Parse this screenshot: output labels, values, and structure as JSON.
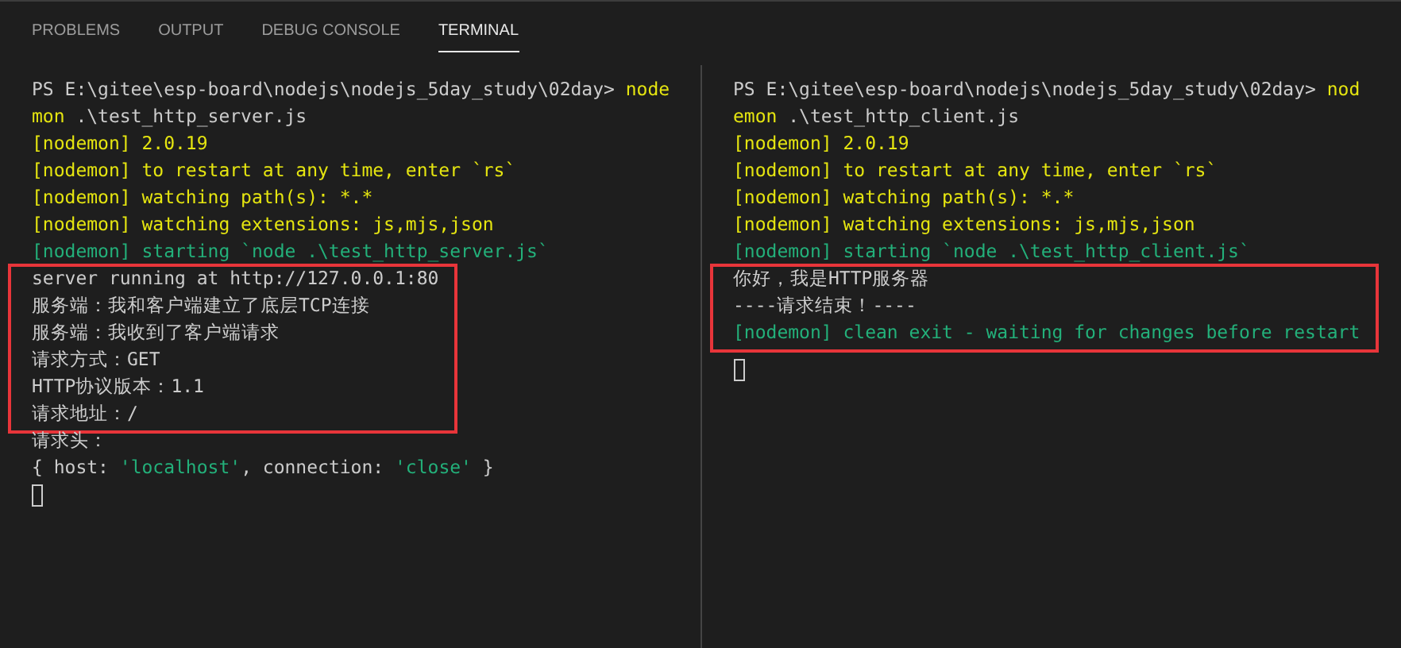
{
  "tabs": [
    {
      "label": "PROBLEMS",
      "selected": false
    },
    {
      "label": "OUTPUT",
      "selected": false
    },
    {
      "label": "DEBUG CONSOLE",
      "selected": false
    },
    {
      "label": "TERMINAL",
      "selected": true
    }
  ],
  "panes": [
    {
      "groups": [
        {
          "highlighted": false,
          "lines": [
            [
              {
                "text": "PS E:\\gitee\\esp-board\\nodejs\\nodejs_5day_study\\02day> ",
                "kind": "plain"
              },
              {
                "text": "node",
                "kind": "yellow"
              }
            ],
            [
              {
                "text": "mon",
                "kind": "yellow"
              },
              {
                "text": " .\\test_http_server.js",
                "kind": "plain"
              }
            ],
            [
              {
                "text": "[nodemon] 2.0.19",
                "kind": "yellow"
              }
            ],
            [
              {
                "text": "[nodemon] to restart at any time, enter `rs`",
                "kind": "yellow"
              }
            ],
            [
              {
                "text": "[nodemon] watching path(s): *.*",
                "kind": "yellow"
              }
            ],
            [
              {
                "text": "[nodemon] watching extensions: js,mjs,json",
                "kind": "yellow"
              }
            ],
            [
              {
                "text": "[nodemon] starting `node .\\test_http_server.js`",
                "kind": "green"
              }
            ]
          ]
        },
        {
          "highlighted": true,
          "lines": [
            [
              {
                "text": "server running at http://127.0.0.1:80",
                "kind": "plain"
              }
            ],
            [
              {
                "text": "服务端：我和客户端建立了底层TCP连接",
                "kind": "plain"
              }
            ],
            [
              {
                "text": "服务端：我收到了客户端请求",
                "kind": "plain"
              }
            ],
            [
              {
                "text": "请求方式：GET",
                "kind": "plain"
              }
            ],
            [
              {
                "text": "HTTP协议版本：1.1",
                "kind": "plain"
              }
            ],
            [
              {
                "text": "请求地址：/",
                "kind": "plain"
              }
            ]
          ]
        },
        {
          "highlighted": false,
          "lines": [
            [
              {
                "text": "请求头：",
                "kind": "plain"
              }
            ],
            [
              {
                "text": "{ host: ",
                "kind": "plain"
              },
              {
                "text": "'localhost'",
                "kind": "green"
              },
              {
                "text": ", connection: ",
                "kind": "plain"
              },
              {
                "text": "'close'",
                "kind": "green"
              },
              {
                "text": " }",
                "kind": "plain"
              }
            ]
          ]
        }
      ],
      "cursor": true
    },
    {
      "groups": [
        {
          "highlighted": false,
          "lines": [
            [
              {
                "text": "PS E:\\gitee\\esp-board\\nodejs\\nodejs_5day_study\\02day> ",
                "kind": "plain"
              },
              {
                "text": "nod",
                "kind": "yellow"
              }
            ],
            [
              {
                "text": "emon",
                "kind": "yellow"
              },
              {
                "text": " .\\test_http_client.js",
                "kind": "plain"
              }
            ],
            [
              {
                "text": "[nodemon] 2.0.19",
                "kind": "yellow"
              }
            ],
            [
              {
                "text": "[nodemon] to restart at any time, enter `rs`",
                "kind": "yellow"
              }
            ],
            [
              {
                "text": "[nodemon] watching path(s): *.*",
                "kind": "yellow"
              }
            ],
            [
              {
                "text": "[nodemon] watching extensions: js,mjs,json",
                "kind": "yellow"
              }
            ],
            [
              {
                "text": "[nodemon] starting `node .\\test_http_client.js`",
                "kind": "green"
              }
            ]
          ]
        },
        {
          "highlighted": true,
          "lines": [
            [
              {
                "text": "你好，我是HTTP服务器",
                "kind": "plain"
              }
            ],
            [
              {
                "text": "----请求结束！----",
                "kind": "plain"
              }
            ],
            [
              {
                "text": "[nodemon] clean exit - waiting for changes before restart",
                "kind": "green"
              }
            ]
          ]
        }
      ],
      "cursor": true
    }
  ]
}
